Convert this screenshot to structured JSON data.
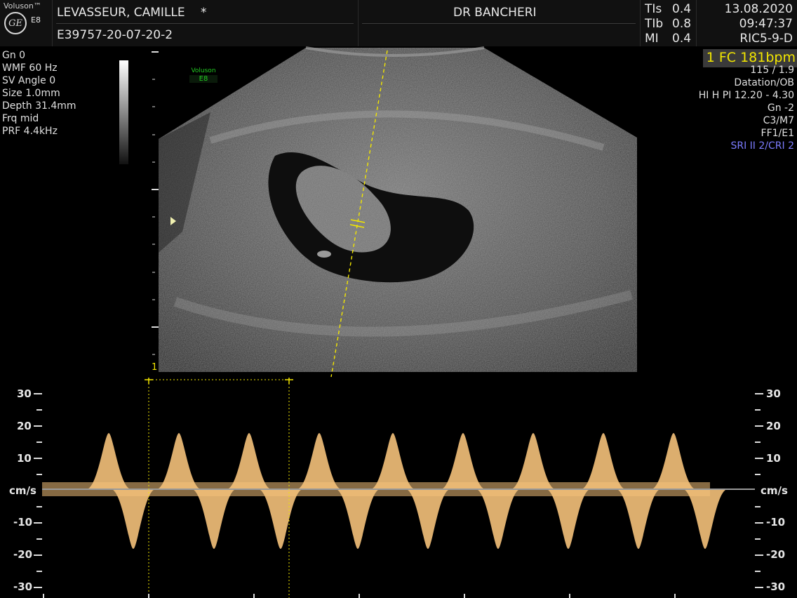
{
  "header": {
    "brand": "Voluson™",
    "model_short": "E8",
    "logo_text": "GE",
    "patient_name": "LEVASSEUR, CAMILLE",
    "patient_flag": "*",
    "exam_id": "E39757-20-07-20-2",
    "doctor": "DR BANCHERI",
    "tis_label": "TIs",
    "tis_value": "0.4",
    "tib_label": "TIb",
    "tib_value": "0.8",
    "mi_label": "MI",
    "mi_value": "0.4",
    "date": "13.08.2020",
    "time": "09:47:37",
    "probe": "RIC5-9-D"
  },
  "left_params": [
    "Gn  0",
    "WMF 60 Hz",
    "SV Angle  0",
    "Size  1.0mm",
    "Depth 31.4mm",
    "Frq mid",
    "PRF  4.4kHz"
  ],
  "right_params": {
    "fc": "1 FC 181bpm",
    "lines": [
      "115 / 1.9",
      "Datation/OB",
      "HI H PI 12.20 - 4.30",
      "Gn  -2",
      "C3/M7",
      "FF1/E1"
    ],
    "sri": "SRI II 2/CRI 2"
  },
  "image_overlay": {
    "brand": "Voluson",
    "model": "E8",
    "cursor_marker": "1"
  },
  "doppler": {
    "unit": "cm/s",
    "scale_left": [
      "30",
      "20",
      "10",
      "-10",
      "-20",
      "-30"
    ],
    "scale_right": [
      "30",
      "20",
      "10",
      "-10",
      "-20",
      "-30"
    ]
  },
  "colors": {
    "accent_yellow": "#f2e600",
    "sri_blue": "#7c7cff",
    "doppler_orange": "#f4c17a",
    "overlay_green": "#22cc22"
  }
}
